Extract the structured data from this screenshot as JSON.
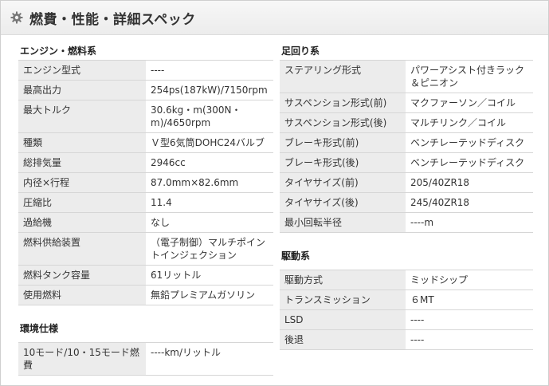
{
  "header": {
    "title": "燃費・性能・詳細スペック"
  },
  "left": {
    "engine": {
      "title": "エンジン・燃料系",
      "rows": [
        {
          "k": "エンジン型式",
          "v": "----"
        },
        {
          "k": "最高出力",
          "v": "254ps(187kW)/7150rpm"
        },
        {
          "k": "最大トルク",
          "v": "30.6kg・m(300N・m)/4650rpm"
        },
        {
          "k": "種類",
          "v": "Ｖ型6気筒DOHC24バルブ"
        },
        {
          "k": "総排気量",
          "v": "2946cc"
        },
        {
          "k": "内径×行程",
          "v": "87.0mm×82.6mm"
        },
        {
          "k": "圧縮比",
          "v": "11.4"
        },
        {
          "k": "過給機",
          "v": "なし"
        },
        {
          "k": "燃料供給装置",
          "v": "（電子制御）マルチポイントインジェクション"
        },
        {
          "k": "燃料タンク容量",
          "v": "61リットル"
        },
        {
          "k": "使用燃料",
          "v": "無鉛プレミアムガソリン"
        }
      ]
    },
    "env": {
      "title": "環境仕様",
      "rows": [
        {
          "k": "10モード/10・15モード燃費",
          "v": "----km/リットル"
        }
      ]
    }
  },
  "right": {
    "chassis": {
      "title": "足回り系",
      "rows": [
        {
          "k": "ステアリング形式",
          "v": "パワーアシスト付きラック＆ピニオン"
        },
        {
          "k": "サスペンション形式(前)",
          "v": "マクファーソン／コイル"
        },
        {
          "k": "サスペンション形式(後)",
          "v": "マルチリンク／コイル"
        },
        {
          "k": "ブレーキ形式(前)",
          "v": "ベンチレーテッドディスク"
        },
        {
          "k": "ブレーキ形式(後)",
          "v": "ベンチレーテッドディスク"
        },
        {
          "k": "タイヤサイズ(前)",
          "v": "205/40ZR18"
        },
        {
          "k": "タイヤサイズ(後)",
          "v": "245/40ZR18"
        },
        {
          "k": "最小回転半径",
          "v": "----m"
        }
      ]
    },
    "drive": {
      "title": "駆動系",
      "rows": [
        {
          "k": "駆動方式",
          "v": "ミッドシップ"
        },
        {
          "k": "トランスミッション",
          "v": "６MT"
        },
        {
          "k": "LSD",
          "v": "----"
        },
        {
          "k": "後退",
          "v": "----"
        }
      ]
    }
  }
}
